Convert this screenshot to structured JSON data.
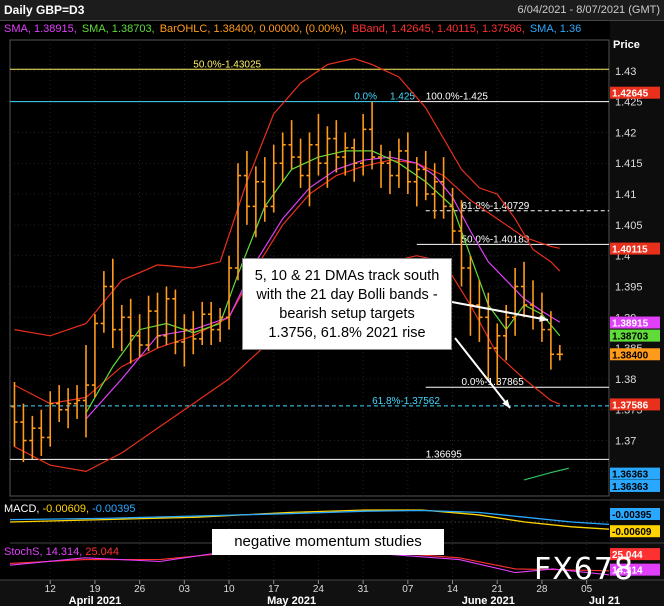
{
  "header": {
    "title": "Daily GBP=D3",
    "range": "6/04/2021 - 8/07/2021 (GMT)"
  },
  "legend": [
    {
      "text": "SMA, 1.38915,",
      "color": "#e040fb"
    },
    {
      "text": "SMA, 1.38703,",
      "color": "#5fdc3a"
    },
    {
      "text": "BarOHLC, 1.38400, 0.00000, (0.00%),",
      "color": "#ff9a1a"
    },
    {
      "text": "BBand, 1.42645, 1.40115, 1.37586,",
      "color": "#ff3030"
    },
    {
      "text": "SMA, 1.36",
      "color": "#2aa8ff"
    }
  ],
  "callout": {
    "lines": [
      "5, 10 & 21 DMAs track south",
      "with the 21 day Bolli bands -",
      "bearish setup targets",
      "1.3756, 61.8% 2021 rise"
    ]
  },
  "momentum_note": "negative momentum studies",
  "brand": "FX678",
  "macd_label": {
    "prefix": "MACD,",
    "v1": "-0.00609,",
    "v2": "-0.00395",
    "c1": "#ffd400",
    "c2": "#2aa8ff"
  },
  "stoch_label": {
    "prefix": "StochS,",
    "v1": "14.314,",
    "v2": "25.044",
    "c1": "#e040fb",
    "c2": "#ff3030"
  },
  "axis_title": "Price",
  "chart_data": {
    "type": "ohlc",
    "title": "Daily GBP=D3",
    "ylim": [
      1.361,
      1.435
    ],
    "yticks": [
      "1.43",
      "1.425",
      "1.42",
      "1.415",
      "1.41",
      "1.405",
      "1.4",
      "1.395",
      "1.39",
      "1.385",
      "1.38",
      "1.375",
      "1.37",
      "1.365"
    ],
    "ytick_values": [
      1.43,
      1.425,
      1.42,
      1.415,
      1.41,
      1.405,
      1.4,
      1.395,
      1.39,
      1.385,
      1.38,
      1.375,
      1.37,
      1.365
    ],
    "xticks": [
      "12",
      "19",
      "26",
      "03",
      "10",
      "17",
      "24",
      "31",
      "07",
      "14",
      "21",
      "28",
      "05"
    ],
    "xtick_bar_index": [
      4,
      9,
      14,
      19,
      24,
      29,
      34,
      39,
      44,
      49,
      54,
      59,
      64
    ],
    "months": [
      "April 2021",
      "May 2021",
      "June 2021",
      "Jul 21"
    ],
    "month_bar_index": [
      9,
      31,
      53,
      66
    ],
    "bars_total": 67,
    "ohlc": [
      [
        1.3755,
        1.3795,
        1.369,
        1.373
      ],
      [
        1.373,
        1.376,
        1.3665,
        1.37
      ],
      [
        1.37,
        1.374,
        1.367,
        1.372
      ],
      [
        1.372,
        1.375,
        1.3675,
        1.3705
      ],
      [
        1.3705,
        1.378,
        1.369,
        1.376
      ],
      [
        1.376,
        1.379,
        1.373,
        1.375
      ],
      [
        1.375,
        1.3785,
        1.372,
        1.376
      ],
      [
        1.376,
        1.379,
        1.3735,
        1.3765
      ],
      [
        1.3765,
        1.3855,
        1.3705,
        1.379
      ],
      [
        1.379,
        1.3905,
        1.377,
        1.389
      ],
      [
        1.389,
        1.3975,
        1.3875,
        1.395
      ],
      [
        1.395,
        1.3995,
        1.385,
        1.388
      ],
      [
        1.388,
        1.392,
        1.3845,
        1.39
      ],
      [
        1.39,
        1.393,
        1.3825,
        1.387
      ],
      [
        1.387,
        1.3905,
        1.3835,
        1.3855
      ],
      [
        1.3855,
        1.3935,
        1.3845,
        1.391
      ],
      [
        1.391,
        1.394,
        1.385,
        1.387
      ],
      [
        1.387,
        1.395,
        1.3855,
        1.393
      ],
      [
        1.393,
        1.3945,
        1.384,
        1.386
      ],
      [
        1.386,
        1.3905,
        1.382,
        1.388
      ],
      [
        1.388,
        1.391,
        1.384,
        1.3865
      ],
      [
        1.3865,
        1.3925,
        1.3855,
        1.3905
      ],
      [
        1.3905,
        1.3925,
        1.3855,
        1.388
      ],
      [
        1.388,
        1.3915,
        1.386,
        1.39
      ],
      [
        1.39,
        1.4,
        1.388,
        1.398
      ],
      [
        1.398,
        1.415,
        1.396,
        1.413
      ],
      [
        1.413,
        1.417,
        1.405,
        1.408
      ],
      [
        1.408,
        1.4145,
        1.403,
        1.412
      ],
      [
        1.412,
        1.416,
        1.4055,
        1.408
      ],
      [
        1.408,
        1.418,
        1.407,
        1.415
      ],
      [
        1.415,
        1.42,
        1.412,
        1.418
      ],
      [
        1.418,
        1.422,
        1.414,
        1.416
      ],
      [
        1.416,
        1.419,
        1.411,
        1.413
      ],
      [
        1.413,
        1.42,
        1.408,
        1.418
      ],
      [
        1.418,
        1.423,
        1.413,
        1.415
      ],
      [
        1.415,
        1.421,
        1.411,
        1.419
      ],
      [
        1.419,
        1.422,
        1.4135,
        1.416
      ],
      [
        1.416,
        1.42,
        1.413,
        1.4175
      ],
      [
        1.4175,
        1.419,
        1.412,
        1.415
      ],
      [
        1.415,
        1.423,
        1.413,
        1.4205
      ],
      [
        1.4205,
        1.425,
        1.414,
        1.416
      ],
      [
        1.416,
        1.418,
        1.411,
        1.415
      ],
      [
        1.415,
        1.417,
        1.41,
        1.413
      ],
      [
        1.413,
        1.419,
        1.411,
        1.417
      ],
      [
        1.417,
        1.42,
        1.41,
        1.412
      ],
      [
        1.412,
        1.416,
        1.408,
        1.414
      ],
      [
        1.414,
        1.417,
        1.409,
        1.41
      ],
      [
        1.41,
        1.415,
        1.406,
        1.412
      ],
      [
        1.412,
        1.416,
        1.406,
        1.408
      ],
      [
        1.408,
        1.411,
        1.402,
        1.404
      ],
      [
        1.404,
        1.409,
        1.395,
        1.398
      ],
      [
        1.398,
        1.4,
        1.387,
        1.392
      ],
      [
        1.392,
        1.396,
        1.386,
        1.39
      ],
      [
        1.39,
        1.394,
        1.38,
        1.385
      ],
      [
        1.385,
        1.389,
        1.379,
        1.387
      ],
      [
        1.387,
        1.392,
        1.383,
        1.39
      ],
      [
        1.39,
        1.398,
        1.387,
        1.395
      ],
      [
        1.395,
        1.399,
        1.39,
        1.392
      ],
      [
        1.392,
        1.396,
        1.388,
        1.39
      ],
      [
        1.39,
        1.394,
        1.386,
        1.388
      ],
      [
        1.388,
        1.391,
        1.3815,
        1.384
      ],
      [
        1.384,
        1.3855,
        1.383,
        1.384
      ]
    ],
    "sma_magenta": [
      [
        8,
        1.3735
      ],
      [
        12,
        1.38
      ],
      [
        16,
        1.387
      ],
      [
        20,
        1.388
      ],
      [
        24,
        1.39
      ],
      [
        27,
        1.399
      ],
      [
        30,
        1.406
      ],
      [
        33,
        1.411
      ],
      [
        36,
        1.414
      ],
      [
        39,
        1.4155
      ],
      [
        42,
        1.416
      ],
      [
        45,
        1.415
      ],
      [
        47,
        1.413
      ],
      [
        49,
        1.4095
      ],
      [
        51,
        1.404
      ],
      [
        53,
        1.399
      ],
      [
        55,
        1.396
      ],
      [
        57,
        1.393
      ],
      [
        59,
        1.391
      ],
      [
        61,
        1.3892
      ]
    ],
    "sma_green": [
      [
        8,
        1.3745
      ],
      [
        11,
        1.382
      ],
      [
        14,
        1.388
      ],
      [
        17,
        1.389
      ],
      [
        20,
        1.3875
      ],
      [
        23,
        1.389
      ],
      [
        25,
        1.397
      ],
      [
        28,
        1.408
      ],
      [
        31,
        1.414
      ],
      [
        34,
        1.416
      ],
      [
        37,
        1.417
      ],
      [
        40,
        1.417
      ],
      [
        43,
        1.415
      ],
      [
        46,
        1.412
      ],
      [
        49,
        1.408
      ],
      [
        51,
        1.4
      ],
      [
        53,
        1.392
      ],
      [
        55,
        1.388
      ],
      [
        57,
        1.392
      ],
      [
        59,
        1.3905
      ],
      [
        61,
        1.387
      ]
    ],
    "bband_upper": [
      [
        0,
        1.388
      ],
      [
        4,
        1.387
      ],
      [
        8,
        1.389
      ],
      [
        12,
        1.396
      ],
      [
        16,
        1.3985
      ],
      [
        20,
        1.398
      ],
      [
        23,
        1.399
      ],
      [
        26,
        1.412
      ],
      [
        29,
        1.423
      ],
      [
        32,
        1.428
      ],
      [
        35,
        1.431
      ],
      [
        38,
        1.432
      ],
      [
        40,
        1.431
      ],
      [
        43,
        1.429
      ],
      [
        46,
        1.424
      ],
      [
        48,
        1.419
      ],
      [
        50,
        1.414
      ],
      [
        52,
        1.411
      ],
      [
        54,
        1.41
      ],
      [
        56,
        1.406
      ],
      [
        58,
        1.401
      ],
      [
        60,
        1.399
      ],
      [
        61,
        1.3975
      ]
    ],
    "bband_middle": [
      [
        0,
        1.379
      ],
      [
        4,
        1.376
      ],
      [
        8,
        1.377
      ],
      [
        12,
        1.382
      ],
      [
        16,
        1.385
      ],
      [
        20,
        1.387
      ],
      [
        24,
        1.39
      ],
      [
        27,
        1.398
      ],
      [
        30,
        1.405
      ],
      [
        33,
        1.41
      ],
      [
        36,
        1.413
      ],
      [
        39,
        1.4145
      ],
      [
        42,
        1.4155
      ],
      [
        45,
        1.415
      ],
      [
        48,
        1.413
      ],
      [
        51,
        1.409
      ],
      [
        54,
        1.406
      ],
      [
        57,
        1.403
      ],
      [
        60,
        1.4015
      ],
      [
        61,
        1.4012
      ]
    ],
    "bband_lower": [
      [
        0,
        1.369
      ],
      [
        4,
        1.366
      ],
      [
        8,
        1.365
      ],
      [
        12,
        1.368
      ],
      [
        16,
        1.372
      ],
      [
        20,
        1.376
      ],
      [
        24,
        1.38
      ],
      [
        27,
        1.384
      ],
      [
        30,
        1.388
      ],
      [
        33,
        1.392
      ],
      [
        36,
        1.395
      ],
      [
        39,
        1.397
      ],
      [
        42,
        1.399
      ],
      [
        45,
        1.4
      ],
      [
        48,
        1.399
      ],
      [
        51,
        1.392
      ],
      [
        54,
        1.384
      ],
      [
        57,
        1.38
      ],
      [
        60,
        1.3765
      ],
      [
        61,
        1.3759
      ]
    ],
    "levels": [
      {
        "label": "50.0%-1.43025",
        "value": 1.43025,
        "color": "#fff066",
        "x_from": 0,
        "x_to": 67,
        "label_bar": 20
      },
      {
        "label": "0.0%",
        "value": 1.425,
        "color": "#44d8ff",
        "x_from": 0,
        "x_to": 43,
        "label_bar": 38,
        "label2": "1.425",
        "label2_bar": 42
      },
      {
        "label": "100.0%-1.425",
        "value": 1.425,
        "color": "#ffffff",
        "x_from": 43,
        "x_to": 67,
        "label_bar": 46
      },
      {
        "label": "61.8%-1.40729",
        "value": 1.40729,
        "color": "#ffffff",
        "x_from": 46,
        "x_to": 67,
        "label_bar": 50,
        "dashed": true
      },
      {
        "label": "50.0%-1.40183",
        "value": 1.40183,
        "color": "#ffffff",
        "x_from": 45,
        "x_to": 67,
        "label_bar": 50
      },
      {
        "label": "0.0%-1.37865",
        "value": 1.37865,
        "color": "#ffffff",
        "x_from": 46,
        "x_to": 67,
        "label_bar": 50
      },
      {
        "label": "61.8%-1.37562",
        "value": 1.37562,
        "color": "#44d8ff",
        "x_from": 0,
        "x_to": 67,
        "label_bar": 40,
        "dashed": true
      },
      {
        "label": "1.36695",
        "value": 1.36695,
        "color": "#ffffff",
        "x_from": 0,
        "x_to": 67,
        "label_bar": 46
      }
    ],
    "price_tags": [
      {
        "text": "1.42645",
        "value": 1.42645,
        "bg": "#e8301c",
        "fg": "#ffffff"
      },
      {
        "text": "1.40115",
        "value": 1.40115,
        "bg": "#e8301c",
        "fg": "#ffffff"
      },
      {
        "text": "1.38915",
        "value": 1.38915,
        "bg": "#e040fb",
        "fg": "#ffffff"
      },
      {
        "text": "1.38703",
        "value": 1.38703,
        "bg": "#5fdc3a",
        "fg": "#000000"
      },
      {
        "text": "1.38400",
        "value": 1.384,
        "bg": "#ff9a1a",
        "fg": "#000000"
      },
      {
        "text": "1.37586",
        "value": 1.37586,
        "bg": "#e8301c",
        "fg": "#ffffff"
      },
      {
        "text": "1.36363",
        "value": 1.36463,
        "bg": "#2aa8ff",
        "fg": "#000000"
      },
      {
        "text": "1.36363",
        "value": 1.36263,
        "bg": "#2aa8ff",
        "fg": "#000000"
      }
    ],
    "macd_tags": [
      {
        "text": "-0.00395",
        "y": 0.35,
        "bg": "#2aa8ff",
        "fg": "#000000"
      },
      {
        "text": "-0.00609",
        "y": 0.78,
        "bg": "#ffd400",
        "fg": "#000000"
      }
    ],
    "stoch_tags": [
      {
        "text": "25.044",
        "y": 0.3,
        "bg": "#ff3030",
        "fg": "#ffffff"
      },
      {
        "text": "14.314",
        "y": 0.72,
        "bg": "#e040fb",
        "fg": "#ffffff"
      }
    ]
  }
}
